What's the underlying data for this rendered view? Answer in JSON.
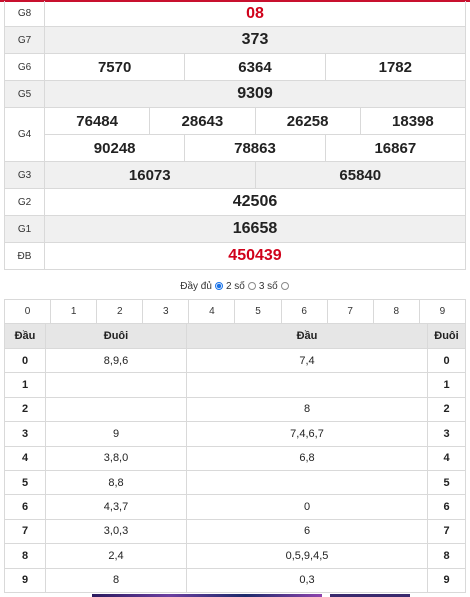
{
  "results": [
    {
      "label": "G8",
      "values": [
        [
          "08"
        ]
      ],
      "red": true
    },
    {
      "label": "G7",
      "values": [
        [
          "373"
        ]
      ]
    },
    {
      "label": "G6",
      "values": [
        [
          "7570",
          "6364",
          "1782"
        ]
      ]
    },
    {
      "label": "G5",
      "values": [
        [
          "9309"
        ]
      ]
    },
    {
      "label": "G4",
      "values": [
        [
          "76484",
          "28643",
          "26258",
          "18398"
        ],
        [
          "90248",
          "78863",
          "16867"
        ]
      ]
    },
    {
      "label": "G3",
      "values": [
        [
          "16073",
          "65840"
        ]
      ]
    },
    {
      "label": "G2",
      "values": [
        [
          "42506"
        ]
      ]
    },
    {
      "label": "G1",
      "values": [
        [
          "16658"
        ]
      ]
    },
    {
      "label": "ĐB",
      "values": [
        [
          "450439"
        ]
      ],
      "red": true
    }
  ],
  "mode": {
    "label": "Đầy đủ",
    "option2": "2 số",
    "option3": "3 số",
    "selected": "2 số"
  },
  "digits": [
    "0",
    "1",
    "2",
    "3",
    "4",
    "5",
    "6",
    "7",
    "8",
    "9"
  ],
  "loto": {
    "headers": [
      "Đầu",
      "Đuôi",
      "Đầu",
      "Đuôi"
    ],
    "rows": [
      {
        "head": "0",
        "tail": "8,9,6",
        "head_list": "7,4",
        "tail_digit": "0"
      },
      {
        "head": "1",
        "tail": "",
        "head_list": "",
        "tail_digit": "1"
      },
      {
        "head": "2",
        "tail": "",
        "head_list": "8",
        "tail_digit": "2"
      },
      {
        "head": "3",
        "tail": "9",
        "head_list": "7,4,6,7",
        "tail_digit": "3"
      },
      {
        "head": "4",
        "tail": "3,8,0",
        "head_list": "6,8",
        "tail_digit": "4"
      },
      {
        "head": "5",
        "tail": "8,8",
        "head_list": "",
        "tail_digit": "5"
      },
      {
        "head": "6",
        "tail": "4,3,7",
        "head_list": "0",
        "tail_digit": "6"
      },
      {
        "head": "7",
        "tail": "3,0,3",
        "head_list": "6",
        "tail_digit": "7"
      },
      {
        "head": "8",
        "tail": "2,4",
        "head_list": "0,5,9,4,5",
        "tail_digit": "8"
      },
      {
        "head": "9",
        "tail": "8",
        "head_list": "0,3",
        "tail_digit": "9"
      }
    ]
  }
}
